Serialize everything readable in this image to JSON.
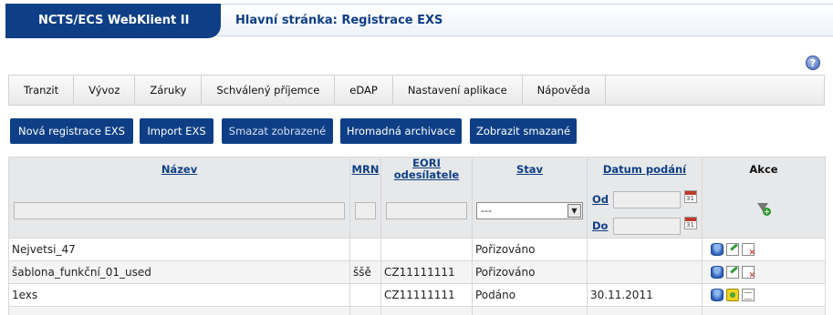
{
  "header": {
    "app_title": "NCTS/ECS WebKlient II",
    "page_title": "Hlavní stránka: Registrace EXS",
    "help_icon": "help-icon"
  },
  "menu": {
    "items": [
      "Tranzit",
      "Vývoz",
      "Záruky",
      "Schválený příjemce",
      "eDAP",
      "Nastavení aplikace",
      "Nápověda"
    ]
  },
  "toolbar": {
    "new_label": "Nová registrace EXS",
    "import_label": "Import EXS",
    "delete_label": "Smazat zobrazené",
    "archive_label": "Hromadná archivace",
    "show_deleted_label": "Zobrazit smazané"
  },
  "table": {
    "headers": {
      "name": "Název",
      "mrn": "MRN",
      "eori_line1": "EORI",
      "eori_line2": "odesílatele",
      "state": "Stav",
      "date": "Datum podání",
      "actions": "Akce"
    },
    "filter": {
      "state_selected": "---",
      "from_label": "Od",
      "to_label": "Do"
    },
    "rows": [
      {
        "name": "Nejvetsi_47",
        "mrn": "",
        "eori": "",
        "state": "Pořizováno",
        "date": "",
        "actions": [
          "open-icon",
          "edit-icon",
          "delete-icon"
        ]
      },
      {
        "name": "šablona_funkční_01_used",
        "mrn": "ššě",
        "eori": "CZ11111111",
        "state": "Pořizováno",
        "date": "",
        "actions": [
          "open-icon",
          "edit-icon",
          "delete-icon"
        ]
      },
      {
        "name": "1exs",
        "mrn": "",
        "eori": "CZ11111111",
        "state": "Podáno",
        "date": "30.11.2011",
        "actions": [
          "open-icon",
          "archive-icon",
          "document-icon"
        ]
      },
      {
        "name": "",
        "mrn": "",
        "eori": "",
        "state": "",
        "date": "",
        "actions": []
      }
    ]
  },
  "colors": {
    "brand_blue": "#0e3f86",
    "header_gray": "#e7e8ea"
  }
}
